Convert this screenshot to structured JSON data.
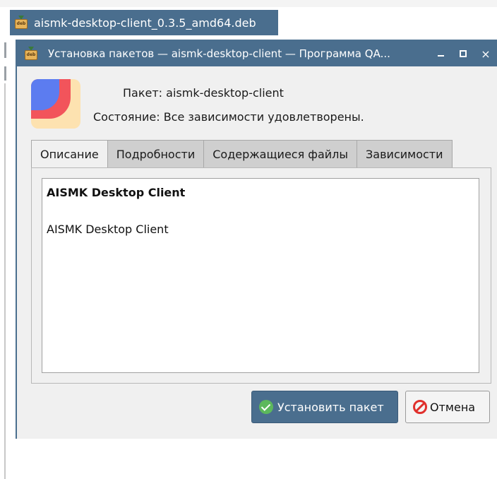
{
  "file_bar": {
    "filename": "aismk-desktop-client_0.3.5_amd64.deb",
    "icon": "deb-package-icon"
  },
  "window": {
    "title": "Установка пакетов — aismk-desktop-client — Программа QA...",
    "controls": {
      "minimize": "minimize",
      "maximize": "maximize",
      "close": "×"
    }
  },
  "package": {
    "package_label": "Пакет:",
    "package_name": "aismk-desktop-client",
    "status_label": "Состояние:",
    "status_value": "Все зависимости удовлетворены."
  },
  "tabs": [
    {
      "label": "Описание",
      "active": true
    },
    {
      "label": "Подробности",
      "active": false
    },
    {
      "label": "Содержащиеся файлы",
      "active": false
    },
    {
      "label": "Зависимости",
      "active": false
    }
  ],
  "description": {
    "title": "AISMK Desktop Client",
    "body": "AISMK Desktop Client"
  },
  "buttons": {
    "install_label": "Установить пакет",
    "cancel_label": "Отмена"
  },
  "colors": {
    "titlebar": "#4a6e8e",
    "install_button": "#4a6e8e",
    "cancel_icon": "#e0302c",
    "check_icon": "#5cb85c"
  }
}
